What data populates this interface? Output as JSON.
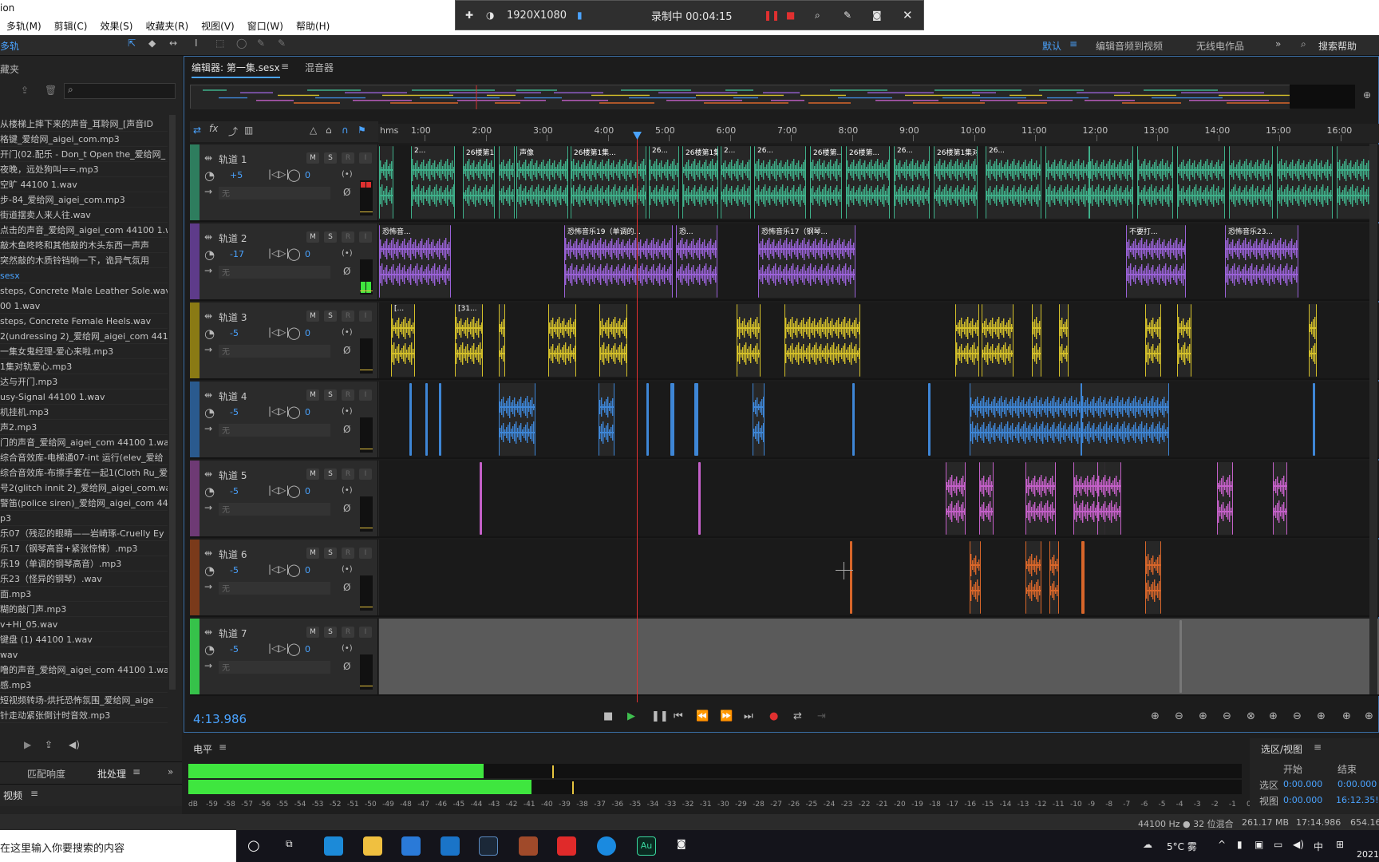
{
  "titlebar": {
    "app": "ion"
  },
  "menu": [
    "多轨(M)",
    "剪辑(C)",
    "效果(S)",
    "收藏夹(R)",
    "视图(V)",
    "窗口(W)",
    "帮助(H)"
  ],
  "recorder": {
    "resolution": "1920X1080",
    "status": "录制中 00:04:15"
  },
  "toolbar": {
    "mode": "多轨",
    "workspace": "默认",
    "workspace_items": [
      "编辑音频到视频",
      "无线电作品"
    ],
    "search": "搜索帮助"
  },
  "left_panel": {
    "title": "藏夹",
    "files": [
      "从楼梯上摔下来的声音_耳聆网_[声音ID",
      "格键_爱给网_aigei_com.mp3",
      "开门(02.配乐 - Don_t Open the_爱给网_",
      "夜晚，远处狗叫==.mp3",
      "空旷 44100 1.wav",
      "步-84_爱给网_aigei_com.mp3",
      "街道摆卖人来人往.wav",
      "点击的声音_爱给网_aigei_com 44100 1.w",
      "敲木鱼咚咚和其他敲的木头东西一声声",
      "突然敲的木质铃铛响一下，诡异气氛用",
      "sesx",
      "steps, Concrete Male Leather Sole.wav",
      "00 1.wav",
      "steps, Concrete Female Heels.wav",
      "2(undressing 2)_爱给网_aigei_com 44100",
      "一集女鬼经理-爱心来啦.mp3",
      "1集对轨爱心.mp3",
      "达与开门.mp3",
      "usy-Signal 44100 1.wav",
      "机挂机.mp3",
      "声2.mp3",
      "门的声音_爱给网_aigei_com 44100 1.wav",
      "综合音效库-电梯通07-int 运行(elev_爱给",
      "综合音效库-布擦手套在一起1(Cloth Ru_爱",
      "号2(glitch innit 2)_爱给网_aigei_com.wav",
      "警笛(police siren)_爱给网_aigei_com 441",
      "p3",
      "乐07（残忍的眼睛——岩崎琢-Cruelly Ey",
      "乐17（钢琴高音+紧张惊悚）.mp3",
      "乐19（单调的钢琴高音）.mp3",
      "乐23（怪异的钢琴）.wav",
      "面.mp3",
      "糊的敲门声.mp3",
      "v+Hi_05.wav",
      "键盘 (1) 44100 1.wav",
      "wav",
      "噜的声音_爱给网_aigei_com 44100 1.wav",
      "感.mp3",
      "短视频转场-烘托恐怖氛围_爱给网_aige",
      "针走动紧张倒计时音效.mp3"
    ],
    "match_tab": "匹配响度",
    "batch_tab": "批处理",
    "video_tab": "视频"
  },
  "editor": {
    "tab_editor": "编辑器: 第一集.sesx",
    "tab_mixer": "混音器",
    "ruler_unit": "hms",
    "ruler": [
      "1:00",
      "2:00",
      "3:00",
      "4:00",
      "5:00",
      "6:00",
      "7:00",
      "8:00",
      "9:00",
      "10:00",
      "11:00",
      "12:00",
      "13:00",
      "14:00",
      "15:00",
      "16:00"
    ],
    "time": "4:13.986",
    "tracks": [
      {
        "name": "轨道 1",
        "vol": "+5",
        "pan": "0",
        "color": "#3fb08a",
        "bar": "#2e7d5e",
        "clips": [
          "2...",
          "2...",
          "26楼第1集对轨爱心",
          "26楼第1集对轨爱心",
          "声像",
          "26楼第1集...",
          "26...",
          "26楼第1集对轨...",
          "2...",
          "26...",
          "26楼第...",
          "26楼第...",
          "26...",
          "26楼第1集对轨爱心",
          "26..."
        ]
      },
      {
        "name": "轨道 2",
        "vol": "-17",
        "pan": "0",
        "color": "#9a62d8",
        "bar": "#5e3b8a",
        "clips": [
          "恐怖音...",
          "恐怖音乐19（单调的...",
          "恐...",
          "恐怖音乐17（钢琴...",
          "不要打...",
          "恐怖音乐23..."
        ]
      },
      {
        "name": "轨道 3",
        "vol": "-5",
        "pan": "0",
        "color": "#d4c02a",
        "bar": "#8a7a14",
        "clips": [
          "[...",
          "[31...",
          "[..."
        ]
      },
      {
        "name": "轨道 4",
        "vol": "-5",
        "pan": "0",
        "color": "#3e86d6",
        "bar": "#2a5a8e",
        "clips": []
      },
      {
        "name": "轨道 5",
        "vol": "-5",
        "pan": "0",
        "color": "#c460c8",
        "bar": "#6e3a74",
        "clips": []
      },
      {
        "name": "轨道 6",
        "vol": "-5",
        "pan": "0",
        "color": "#d8662a",
        "bar": "#7a3a1a",
        "clips": []
      },
      {
        "name": "轨道 7",
        "vol": "-5",
        "pan": "0",
        "color": "#777777",
        "bar": "#36c24a",
        "clips": []
      }
    ],
    "input_placeholder": "无"
  },
  "level": {
    "title": "电平",
    "scale": [
      "dB",
      "-59",
      "-58",
      "-57",
      "-56",
      "-55",
      "-54",
      "-53",
      "-52",
      "-51",
      "-50",
      "-49",
      "-48",
      "-47",
      "-46",
      "-45",
      "-44",
      "-43",
      "-42",
      "-41",
      "-40",
      "-39",
      "-38",
      "-37",
      "-36",
      "-35",
      "-34",
      "-33",
      "-32",
      "-31",
      "-30",
      "-29",
      "-28",
      "-27",
      "-26",
      "-25",
      "-24",
      "-23",
      "-22",
      "-21",
      "-20",
      "-19",
      "-18",
      "-17",
      "-16",
      "-15",
      "-14",
      "-13",
      "-12",
      "-11",
      "-10",
      "-9",
      "-8",
      "-7",
      "-6",
      "-5",
      "-4",
      "-3",
      "-2",
      "-1",
      "0"
    ]
  },
  "selection": {
    "title": "选区/视图",
    "start_label": "开始",
    "end_label": "结束",
    "sel_label": "选区",
    "view_label": "视图",
    "sel_start": "0:00.000",
    "sel_end": "0:00.000",
    "view_start": "0:00.000",
    "view_end": "16:12.35!"
  },
  "status": {
    "rate": "44100 Hz ● 32 位混合",
    "size": "261.17 MB",
    "duration": "17:14.986",
    "free": "654.16"
  },
  "taskbar": {
    "search": "在这里输入你要搜索的内容",
    "weather": "5°C 雾",
    "ime": "中",
    "clock": "2021"
  }
}
